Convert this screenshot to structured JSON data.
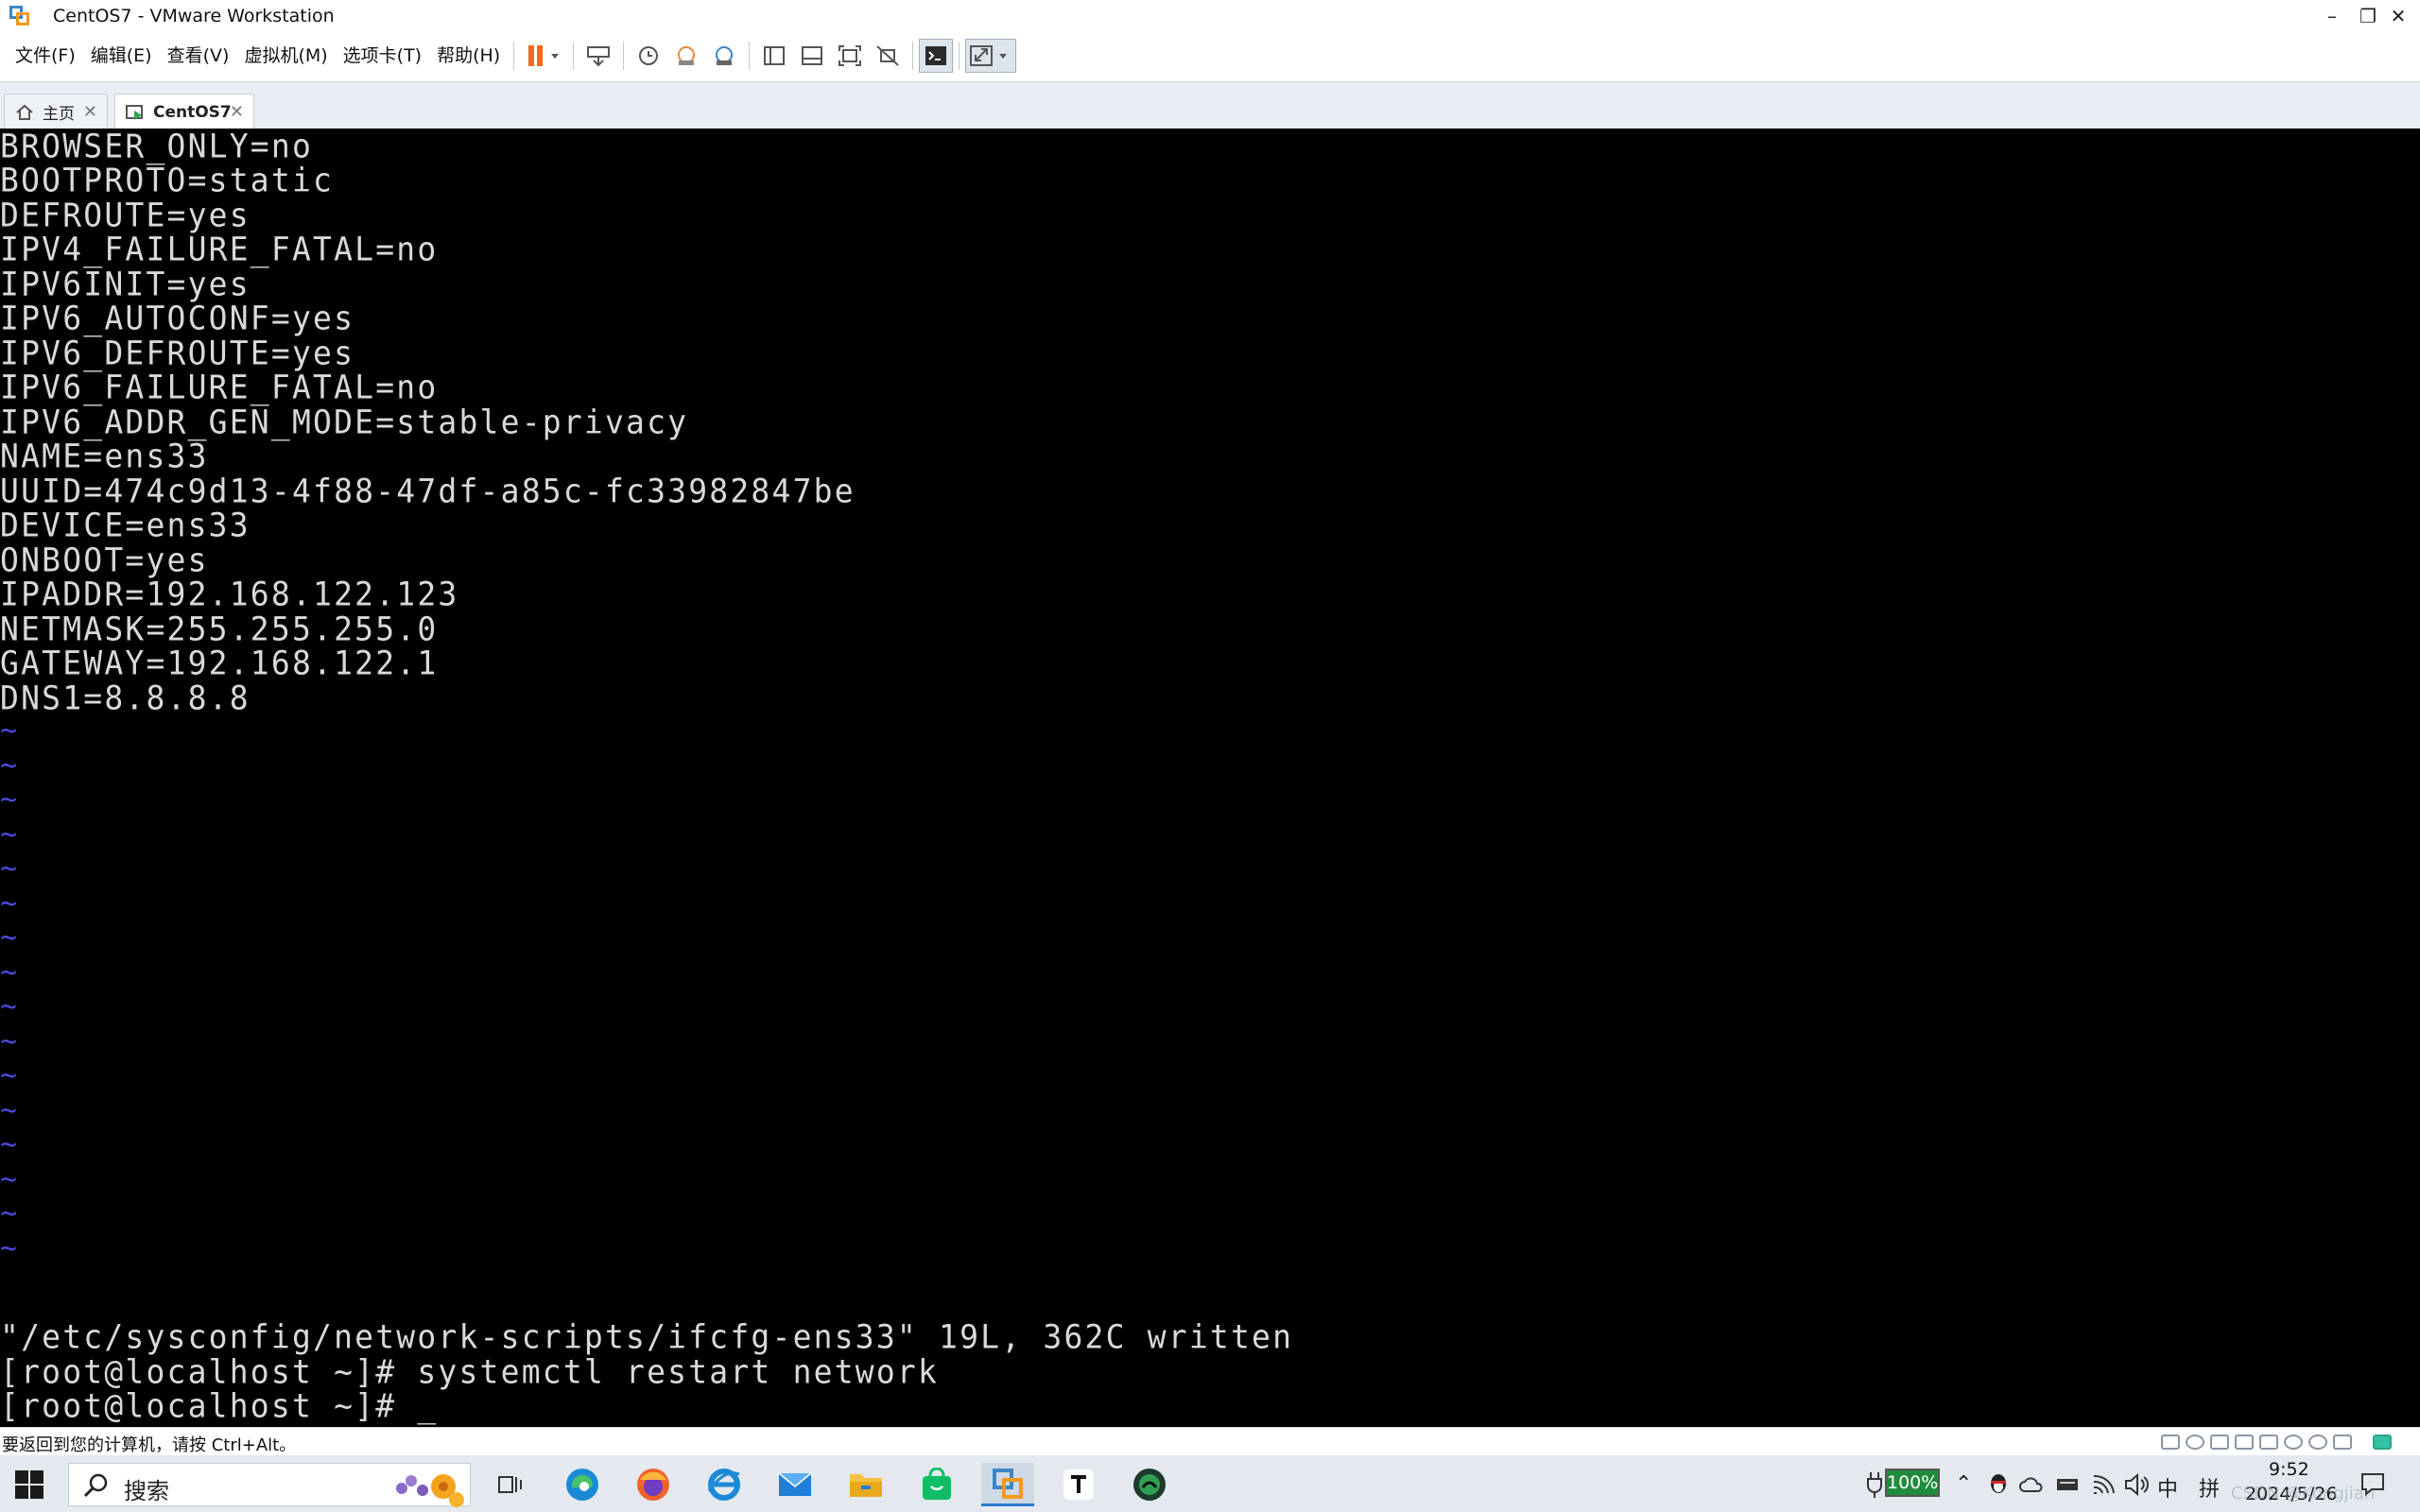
{
  "window": {
    "title": "CentOS7 - VMware Workstation",
    "controls": {
      "minimize": "–",
      "restore": "❐",
      "close": "✕"
    }
  },
  "menu": [
    "文件(F)",
    "编辑(E)",
    "查看(V)",
    "虚拟机(M)",
    "选项卡(T)",
    "帮助(H)"
  ],
  "tabs": [
    {
      "label": "主页",
      "close": "✕"
    },
    {
      "label": "CentOS7",
      "close": "✕"
    }
  ],
  "console": {
    "lines": [
      "BROWSER_ONLY=no",
      "BOOTPROTO=static",
      "DEFROUTE=yes",
      "IPV4_FAILURE_FATAL=no",
      "IPV6INIT=yes",
      "IPV6_AUTOCONF=yes",
      "IPV6_DEFROUTE=yes",
      "IPV6_FAILURE_FATAL=no",
      "IPV6_ADDR_GEN_MODE=stable-privacy",
      "NAME=ens33",
      "UUID=474c9d13-4f88-47df-a85c-fc33982847be",
      "DEVICE=ens33",
      "ONBOOT=yes",
      "IPADDR=192.168.122.123",
      "NETMASK=255.255.255.0",
      "GATEWAY=192.168.122.1",
      "DNS1=8.8.8.8"
    ],
    "tilde": "~",
    "footer": [
      "\"/etc/sysconfig/network-scripts/ifcfg-ens33\" 19L, 362C written",
      "[root@localhost ~]# systemctl restart network",
      "[root@localhost ~]# _"
    ]
  },
  "statusbar": {
    "text": "要返回到您的计算机，请按 Ctrl+Alt。"
  },
  "taskbar": {
    "search_placeholder": "搜索",
    "battery": "100%",
    "ime": "中",
    "ime2": "拼",
    "time": "9:52",
    "date": "2024/5/26",
    "watermark": "CSDN @Kongjian"
  },
  "colors": {
    "console_bg": "#000000",
    "console_text": "#d9d9d9",
    "tilde": "#4a4ade",
    "accent": "#3b86c6"
  }
}
